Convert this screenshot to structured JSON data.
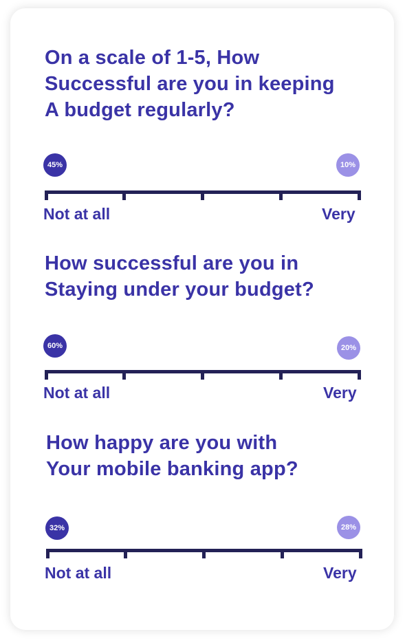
{
  "questions": [
    {
      "text": "On a scale of 1-5, How\nSuccessful are you in keeping\nA budget regularly?",
      "left_value": "45%",
      "right_value": "10%",
      "left_label": "Not at all",
      "right_label": "Very"
    },
    {
      "text": "How successful are you in\nStaying under your budget?",
      "left_value": "60%",
      "right_value": "20%",
      "left_label": "Not at all",
      "right_label": "Very"
    },
    {
      "text": "How happy are you with\nYour mobile banking app?",
      "left_value": "32%",
      "right_value": "28%",
      "left_label": "Not at all",
      "right_label": "Very"
    }
  ],
  "colors": {
    "accent": "#3a33a6",
    "accent_light": "#9b91e6",
    "scale_line": "#232156"
  }
}
